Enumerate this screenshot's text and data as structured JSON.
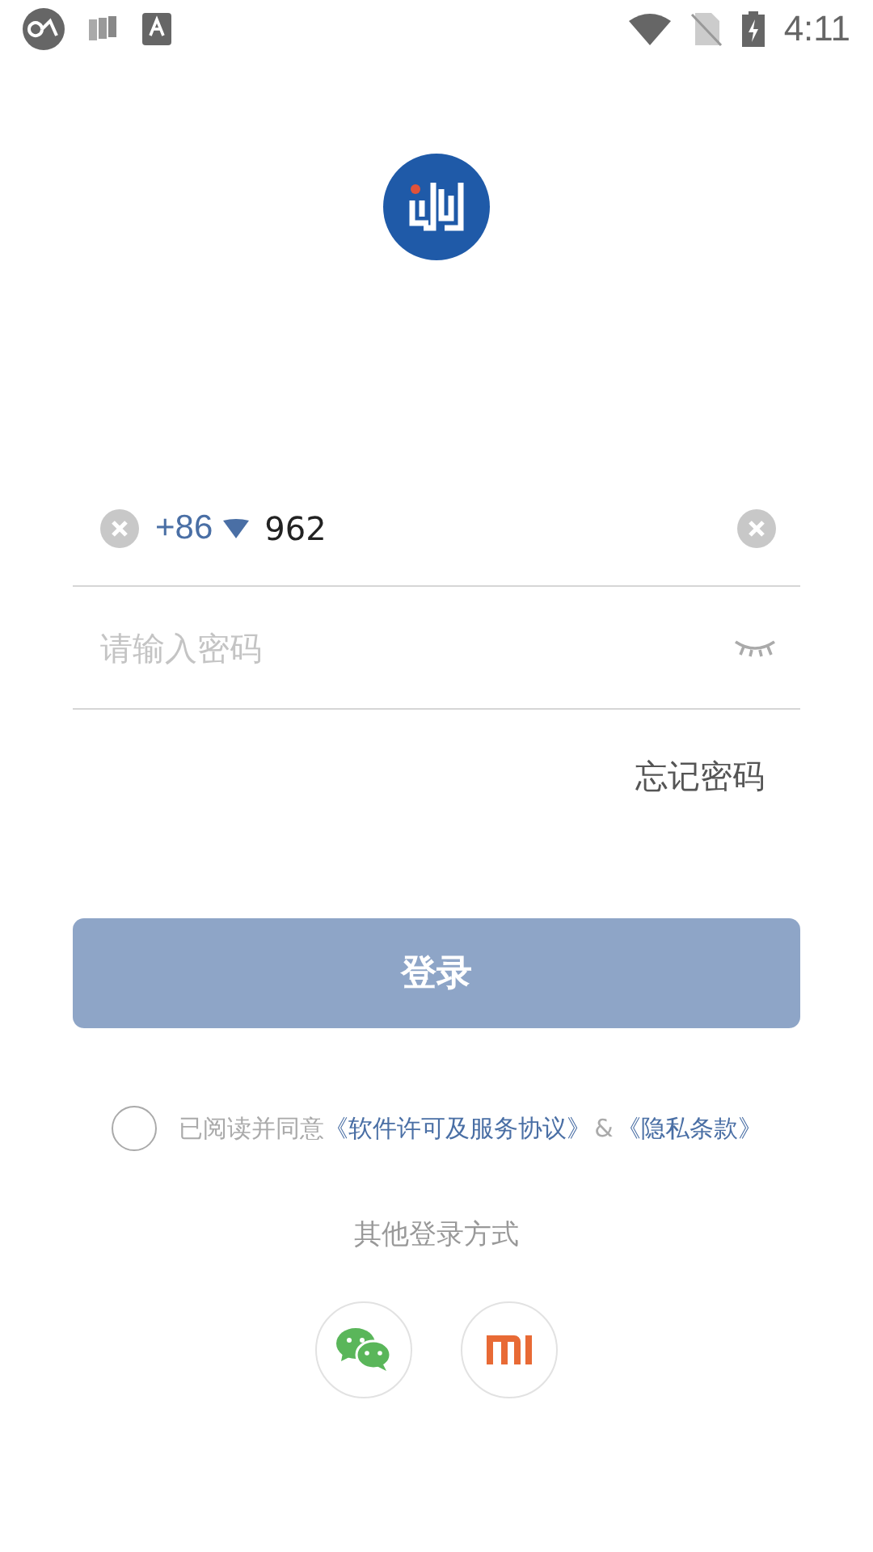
{
  "status_bar": {
    "time": "4:11"
  },
  "phone": {
    "country_code": "+86",
    "value": "962"
  },
  "password": {
    "placeholder": "请输入密码"
  },
  "forgot_password": "忘记密码",
  "login_button": {
    "label": "登录",
    "disabled": true
  },
  "agreement": {
    "checked": false,
    "prefix": "已阅读并同意",
    "links": [
      {
        "label": "《软件许可及服务协议》"
      },
      {
        "label": "《隐私条款》"
      }
    ],
    "joiner": "&"
  },
  "other_login": {
    "title": "其他登录方式",
    "options": [
      {
        "kind": "wechat"
      },
      {
        "kind": "mi"
      }
    ]
  }
}
